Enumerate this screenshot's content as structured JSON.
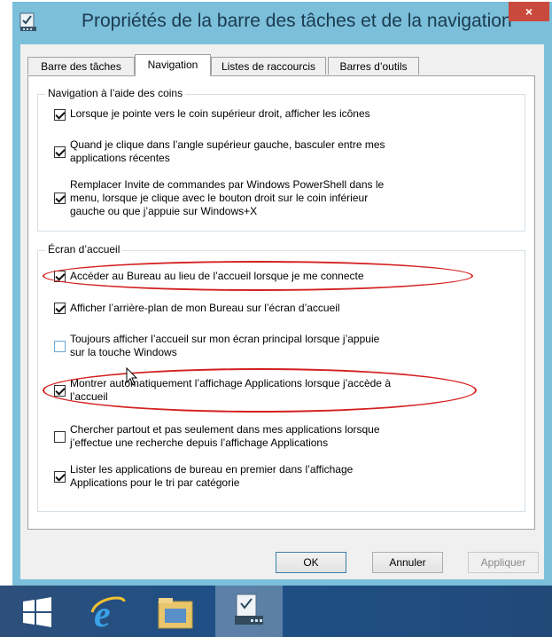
{
  "window": {
    "title": "Propriétés de la barre des tâches et de la navigation",
    "close_label": "×"
  },
  "tabs": [
    {
      "label": "Barre des tâches",
      "active": false
    },
    {
      "label": "Navigation",
      "active": true
    },
    {
      "label": "Listes de raccourcis",
      "active": false
    },
    {
      "label": "Barres d’outils",
      "active": false
    }
  ],
  "corners": {
    "title": "Navigation à l’aide des coins",
    "options": [
      {
        "lines": [
          "Lorsque je pointe vers le coin supérieur droit, afficher les icônes"
        ],
        "checked": true
      },
      {
        "lines": [
          "Quand je clique dans l’angle supérieur gauche, basculer entre mes",
          "applications récentes"
        ],
        "checked": true
      },
      {
        "lines": [
          "Remplacer Invite de commandes par Windows PowerShell dans le",
          "menu, lorsque je clique avec le bouton droit sur le coin inférieur",
          "gauche ou que j’appuie sur Windows+X"
        ],
        "checked": true
      }
    ]
  },
  "start": {
    "title": "Écran d’accueil",
    "options": [
      {
        "lines": [
          "Accéder au Bureau au lieu de l’accueil lorsque je me connecte"
        ],
        "checked": true,
        "highlighted": true
      },
      {
        "lines": [
          "Afficher l’arrière-plan de mon Bureau sur l’écran d’accueil"
        ],
        "checked": true
      },
      {
        "lines": [
          "Toujours afficher l’accueil sur mon écran principal lorsque j’appuie",
          "sur la touche Windows"
        ],
        "checked": false
      },
      {
        "lines": [
          "Montrer automatiquement l’affichage Applications lorsque j’accède à",
          "l’accueil"
        ],
        "checked": true,
        "highlighted": true
      },
      {
        "lines": [
          "Chercher partout et pas seulement dans mes applications lorsque",
          "j’effectue une recherche depuis l’affichage Applications"
        ],
        "checked": false
      },
      {
        "lines": [
          "Lister les applications de bureau en premier dans l’affichage",
          "Applications pour le tri par catégorie"
        ],
        "checked": true
      }
    ]
  },
  "buttons": {
    "ok": "OK",
    "cancel": "Annuler",
    "apply": "Appliquer"
  },
  "colors": {
    "accent_frame": "#7bbfda",
    "close": "#c94a3c",
    "highlight_ellipse": "#d42020",
    "taskbar": "#1e4f86"
  },
  "taskbar": {
    "items": [
      "windows-logo-icon",
      "internet-explorer-icon",
      "file-explorer-icon",
      "taskbar-properties-icon"
    ]
  }
}
